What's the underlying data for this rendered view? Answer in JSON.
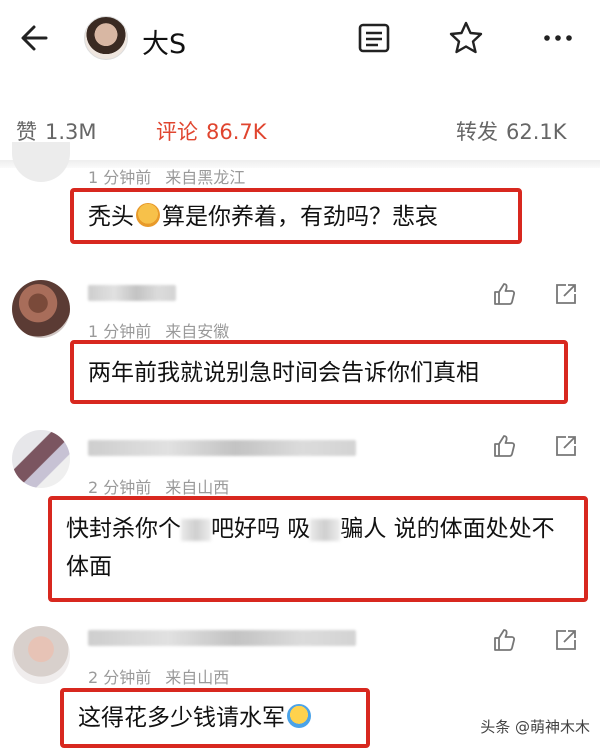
{
  "header": {
    "title": "大S"
  },
  "stats": {
    "likes_label": "赞",
    "likes_value": "1.3M",
    "comments_label": "评论",
    "comments_value": "86.7K",
    "reposts_label": "转发",
    "reposts_value": "62.1K"
  },
  "comments": [
    {
      "time": "1 分钟前",
      "source": "来自黑龙江",
      "text_a": "秃头",
      "text_b": "算是你养着，有劲吗？悲哀"
    },
    {
      "time": "1 分钟前",
      "source": "来自安徽",
      "text": "两年前我就说别急时间会告诉你们真相"
    },
    {
      "time": "2 分钟前",
      "source": "来自山西",
      "text_a": "快封杀你个",
      "text_b": "吧好吗 吸",
      "text_c": "骗人 说的体面处处不体面"
    },
    {
      "time": "2 分钟前",
      "source": "来自山西",
      "text": "这得花多少钱请水军"
    }
  ],
  "watermark": "头条 @萌神木木",
  "colors": {
    "accent": "#e0452f",
    "highlight_border": "#d8281f"
  },
  "icons": [
    "back-arrow-icon",
    "notes-icon",
    "star-icon",
    "more-icon",
    "like-icon",
    "share-icon"
  ]
}
